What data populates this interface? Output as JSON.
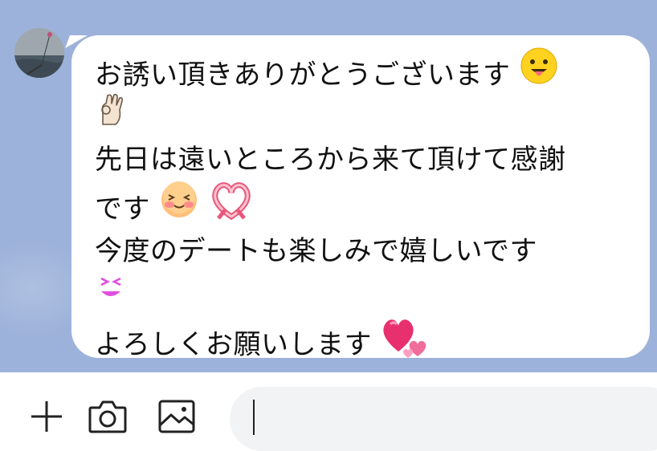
{
  "app": {
    "accent_color": "#9db2da",
    "bubble_color": "#ffffff"
  },
  "message": {
    "line1": "お誘い頂きありがとうございます",
    "line3": "先日は遠いところから来て頂けて感謝",
    "line4": "です",
    "line5": "今度のデートも楽しみで嬉しいです",
    "line7": "よろしくお願いします",
    "emojis": [
      "tongue-face-icon",
      "ok-hand-icon",
      "blush-face-icon",
      "ribbon-heart-icon",
      "squint-eyes-icon",
      "two-hearts-icon"
    ]
  },
  "toolbar": {
    "icons": [
      "plus-icon",
      "camera-icon",
      "image-icon"
    ]
  },
  "input": {
    "value": ""
  }
}
